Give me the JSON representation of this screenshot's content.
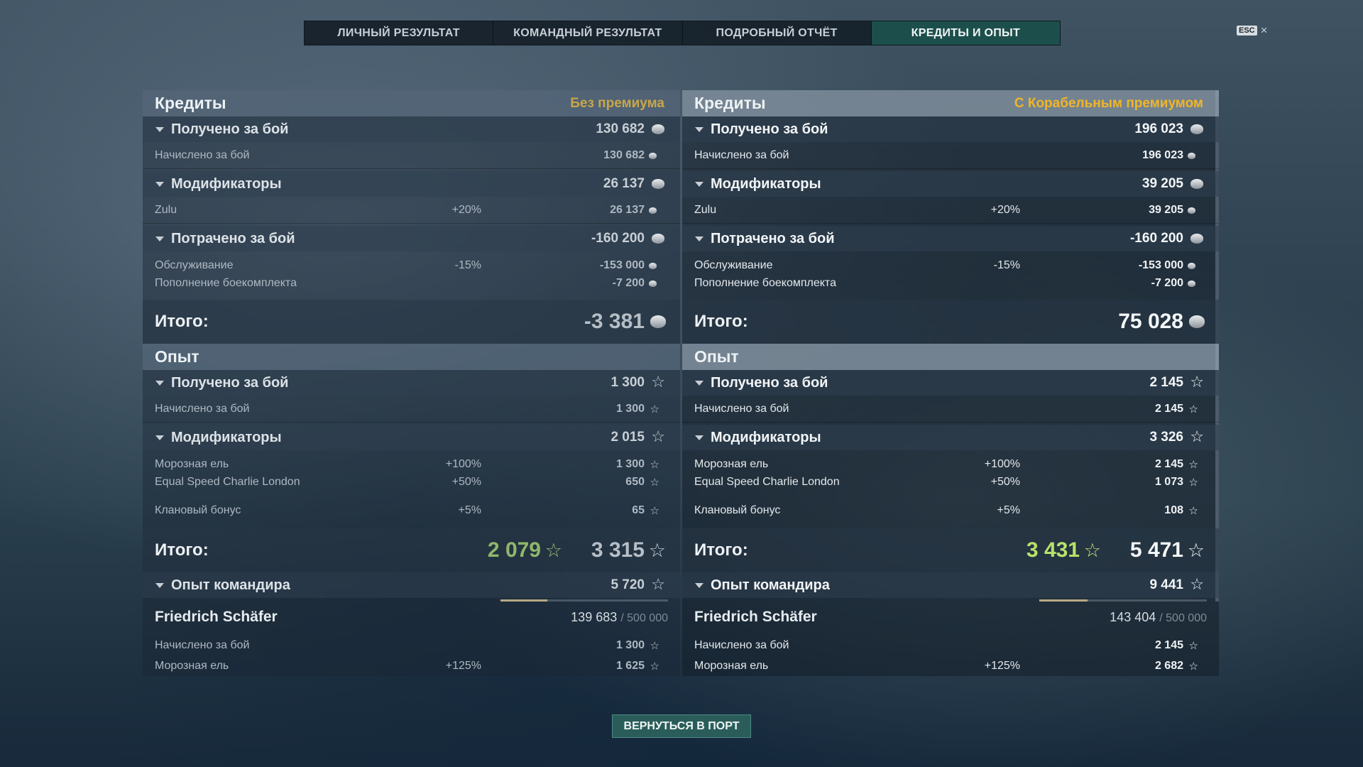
{
  "tabs": [
    "ЛИЧНЫЙ РЕЗУЛЬТАТ",
    "КОМАНДНЫЙ РЕЗУЛЬТАТ",
    "ПОДРОБНЫЙ ОТЧЁТ",
    "КРЕДИТЫ И ОПЫТ"
  ],
  "active_tab": "КРЕДИТЫ И ОПЫТ",
  "esc": {
    "key": "ESC",
    "close": "×"
  },
  "accent_colors": {
    "premium": "#f0b52a",
    "total_green": "#b7e26a",
    "active_tab": "#1c4f4c"
  },
  "left": {
    "credits": {
      "title": "Кредиты",
      "premium_label": "Без премиума",
      "earned": {
        "label": "Получено за бой",
        "value": "130 682"
      },
      "earned_rows": [
        {
          "label": "Начислено за бой",
          "value": "130 682"
        }
      ],
      "modifiers": {
        "label": "Модификаторы",
        "value": "26 137"
      },
      "modifier_rows": [
        {
          "label": "Zulu",
          "pct": "+20%",
          "value": "26 137"
        }
      ],
      "spent": {
        "label": "Потрачено за бой",
        "value": "-160 200"
      },
      "spent_rows": [
        {
          "label": "Обслуживание",
          "pct": "-15%",
          "value": "-153 000"
        },
        {
          "label": "Пополнение боекомплекта",
          "value": "-7 200"
        }
      ],
      "total": {
        "label": "Итого:",
        "value": "-3 381"
      }
    },
    "xp": {
      "title": "Опыт",
      "earned": {
        "label": "Получено за бой",
        "value": "1 300"
      },
      "earned_rows": [
        {
          "label": "Начислено за бой",
          "value": "1 300"
        }
      ],
      "modifiers": {
        "label": "Модификаторы",
        "value": "2 015"
      },
      "modifier_rows": [
        {
          "label": "Морозная ель",
          "pct": "+100%",
          "value": "1 300"
        },
        {
          "label": "Equal Speed Charlie London",
          "pct": "+50%",
          "value": "650"
        },
        {
          "label": "Клановый бонус",
          "pct": "+5%",
          "value": "65"
        }
      ],
      "total": {
        "label": "Итого:",
        "free_value": "2 079",
        "value": "3 315"
      },
      "commander": {
        "label": "Опыт командира",
        "value": "5 720"
      },
      "commander_name": "Friedrich Schäfer",
      "commander_progress": {
        "current": "139 683",
        "max": "/ 500 000",
        "fraction": 0.279
      },
      "commander_rows": [
        {
          "label": "Начислено за бой",
          "value": "1 300"
        },
        {
          "label": "Морозная ель",
          "pct": "+125%",
          "value": "1 625"
        }
      ]
    }
  },
  "right": {
    "credits": {
      "title": "Кредиты",
      "premium_label": "С Корабельным премиумом",
      "earned": {
        "label": "Получено за бой",
        "value": "196 023"
      },
      "earned_rows": [
        {
          "label": "Начислено за бой",
          "value": "196 023"
        }
      ],
      "modifiers": {
        "label": "Модификаторы",
        "value": "39 205"
      },
      "modifier_rows": [
        {
          "label": "Zulu",
          "pct": "+20%",
          "value": "39 205"
        }
      ],
      "spent": {
        "label": "Потрачено за бой",
        "value": "-160 200"
      },
      "spent_rows": [
        {
          "label": "Обслуживание",
          "pct": "-15%",
          "value": "-153 000"
        },
        {
          "label": "Пополнение боекомплекта",
          "value": "-7 200"
        }
      ],
      "total": {
        "label": "Итого:",
        "value": "75 028"
      }
    },
    "xp": {
      "title": "Опыт",
      "earned": {
        "label": "Получено за бой",
        "value": "2 145"
      },
      "earned_rows": [
        {
          "label": "Начислено за бой",
          "value": "2 145"
        }
      ],
      "modifiers": {
        "label": "Модификаторы",
        "value": "3 326"
      },
      "modifier_rows": [
        {
          "label": "Морозная ель",
          "pct": "+100%",
          "value": "2 145"
        },
        {
          "label": "Equal Speed Charlie London",
          "pct": "+50%",
          "value": "1 073"
        },
        {
          "label": "Клановый бонус",
          "pct": "+5%",
          "value": "108"
        }
      ],
      "total": {
        "label": "Итого:",
        "free_value": "3 431",
        "value": "5 471"
      },
      "commander": {
        "label": "Опыт командира",
        "value": "9 441"
      },
      "commander_name": "Friedrich Schäfer",
      "commander_progress": {
        "current": "143 404",
        "max": "/ 500 000",
        "fraction": 0.287
      },
      "commander_rows": [
        {
          "label": "Начислено за бой",
          "value": "2 145"
        },
        {
          "label": "Морозная ель",
          "pct": "+125%",
          "value": "2 682"
        }
      ]
    }
  },
  "back_button": "ВЕРНУТЬСЯ В ПОРТ"
}
